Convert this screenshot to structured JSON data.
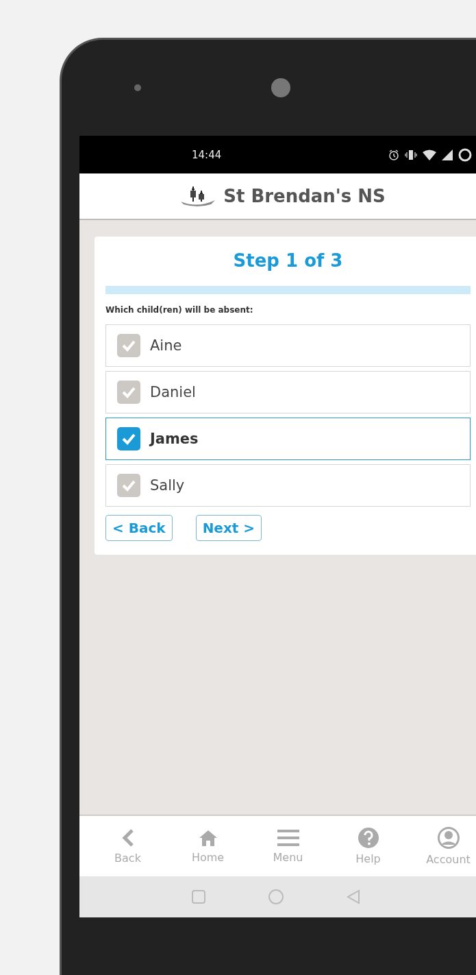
{
  "status_bar": {
    "time": "14:44"
  },
  "header": {
    "title": "St Brendan's NS"
  },
  "wizard": {
    "step": "Step 1 of 3",
    "progress": {
      "level": 1
    },
    "question": "Which child(ren) will be absent:",
    "children": [
      {
        "name": "Aine",
        "checked": false
      },
      {
        "name": "Daniel",
        "checked": false
      },
      {
        "name": "James",
        "checked": true
      },
      {
        "name": "Sally",
        "checked": false
      }
    ],
    "buttons": [
      {
        "label": "< Back"
      },
      {
        "label": "Next >"
      }
    ]
  },
  "bottom_nav": [
    {
      "label": "Back",
      "kind": "back"
    },
    {
      "label": "Home",
      "kind": "home"
    },
    {
      "label": "Menu",
      "kind": "menu"
    },
    {
      "label": "Help",
      "kind": "help"
    },
    {
      "label": "Account",
      "kind": "account"
    }
  ]
}
